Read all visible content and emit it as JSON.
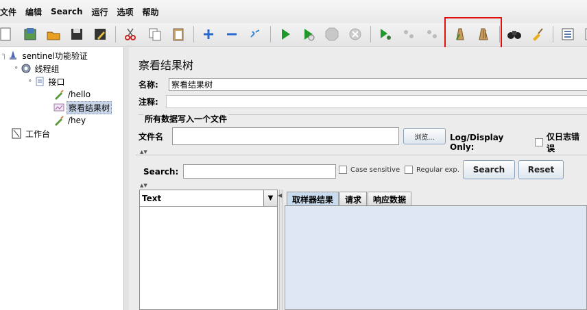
{
  "menu": [
    "文件",
    "编辑",
    "Search",
    "运行",
    "选项",
    "帮助"
  ],
  "toolbar_icons": [
    "new-icon",
    "templates-icon",
    "open-icon",
    "save-icon",
    "save-as-icon",
    "cut-icon",
    "copy-icon",
    "paste-icon",
    "expand-icon",
    "collapse-icon",
    "toggle-icon",
    "start-icon",
    "start-no-pause-icon",
    "stop-icon",
    "shutdown-icon",
    "remote-start-icon",
    "remote-stop-icon",
    "remote-shutdown-icon",
    "clear-icon",
    "clear-all-icon",
    "search-icon",
    "reset-search-icon",
    "function-helper-icon"
  ],
  "tree": {
    "root": "sentinel功能验证",
    "thread_group": "线程组",
    "controller": "接口",
    "sampler1": "/hello",
    "listener": "察看结果树",
    "sampler2": "/hey",
    "workbench": "工作台"
  },
  "panel": {
    "title": "察看结果树",
    "name_label": "名称:",
    "name_value": "察看结果树",
    "comment_label": "注释:",
    "comment_value": "",
    "file_section": "所有数据写入一个文件",
    "filename_label": "文件名",
    "filename_value": "",
    "browse": "浏览...",
    "log_display_label": "Log/Display Only:",
    "errors_only_label": "仅日志错误"
  },
  "search": {
    "label": "Search:",
    "value": "",
    "case_sensitive": "Case sensitive",
    "regular_exp": "Regular exp.",
    "search_button": "Search",
    "reset_button": "Reset"
  },
  "renderer": {
    "selected": "Text"
  },
  "tabs": [
    "取样器结果",
    "请求",
    "响应数据"
  ],
  "colors": {
    "highlight": "#e01010",
    "selection": "#c9d6ea",
    "tab_active": "#c9dcef"
  }
}
